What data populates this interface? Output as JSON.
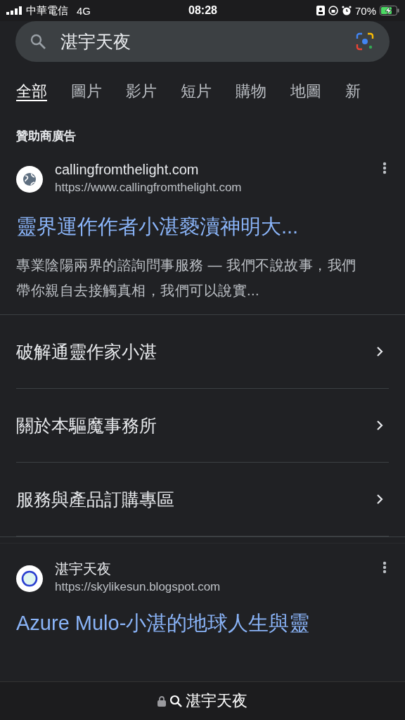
{
  "status_bar": {
    "carrier": "中華電信",
    "network": "4G",
    "time": "08:28",
    "battery": "70%"
  },
  "search": {
    "value": "湛宇天夜"
  },
  "tabs": [
    {
      "label": "全部",
      "selected": true
    },
    {
      "label": "圖片",
      "selected": false
    },
    {
      "label": "影片",
      "selected": false
    },
    {
      "label": "短片",
      "selected": false
    },
    {
      "label": "購物",
      "selected": false
    },
    {
      "label": "地圖",
      "selected": false
    },
    {
      "label": "新",
      "selected": false
    }
  ],
  "ad": {
    "label": "贊助商廣告",
    "site": "callingfromthelight.com",
    "url": "https://www.callingfromthelight.com",
    "title": "靈界運作作者小湛褻瀆神明大...",
    "description": "專業陰陽兩界的諮詢問事服務 — 我們不說故事，我們帶你親自去接觸真相，我們可以說實...",
    "sitelinks": [
      "破解通靈作家小湛",
      "關於本驅魔事務所",
      "服務與產品訂購專區"
    ]
  },
  "result": {
    "site": "湛宇天夜",
    "url": "https://skylikesun.blogspot.com",
    "title": "Azure Mulo-小湛的地球人生與靈"
  },
  "bottom_bar": {
    "query": "湛宇天夜"
  }
}
